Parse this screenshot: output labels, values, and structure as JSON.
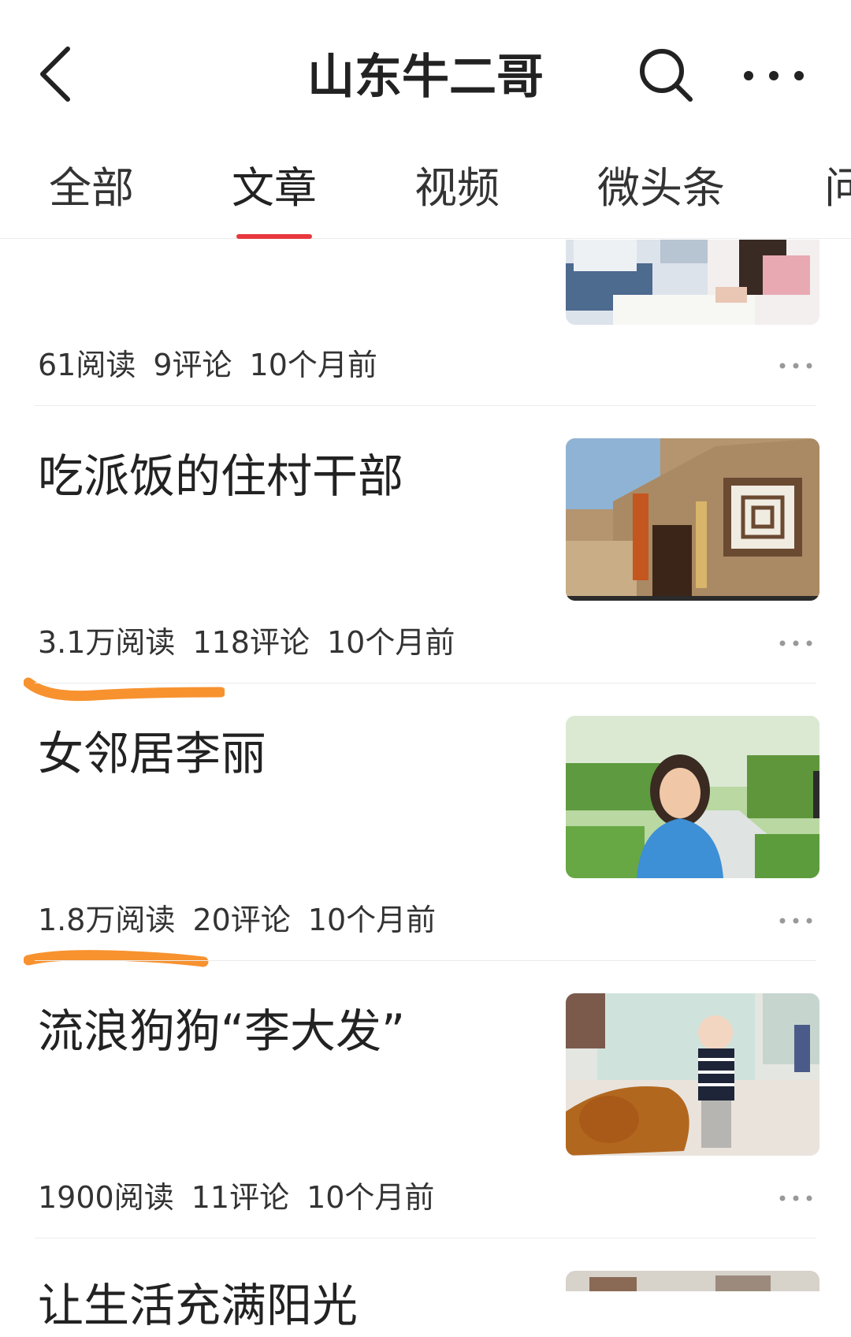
{
  "header": {
    "title": "山东牛二哥"
  },
  "tabs": [
    {
      "label": "全部"
    },
    {
      "label": "文章"
    },
    {
      "label": "视频"
    },
    {
      "label": "微头条"
    },
    {
      "label": "问"
    }
  ],
  "articles": [
    {
      "title": "",
      "reads": "61阅读",
      "comments": "9评论",
      "time": "10个月前",
      "image": "classroom-students-photo"
    },
    {
      "title": "吃派饭的住村干部",
      "reads": "3.1万阅读",
      "comments": "118评论",
      "time": "10个月前",
      "image": "cave-dwelling-photo",
      "highlighted": true
    },
    {
      "title": "女邻居李丽",
      "reads": "1.8万阅读",
      "comments": "20评论",
      "time": "10个月前",
      "image": "woman-in-park-photo",
      "highlighted": true
    },
    {
      "title": "流浪狗狗“李大发”",
      "reads": "1900阅读",
      "comments": "11评论",
      "time": "10个月前",
      "image": "baby-with-dog-photo"
    },
    {
      "title": "让生活充满阳光",
      "image": "people-photo"
    }
  ],
  "colors": {
    "accent": "#e8383d",
    "annotation": "#f7922f",
    "divider": "#ebebeb"
  },
  "icons": [
    "back-arrow-icon",
    "search-icon",
    "more-icon",
    "ellipsis-icon"
  ]
}
